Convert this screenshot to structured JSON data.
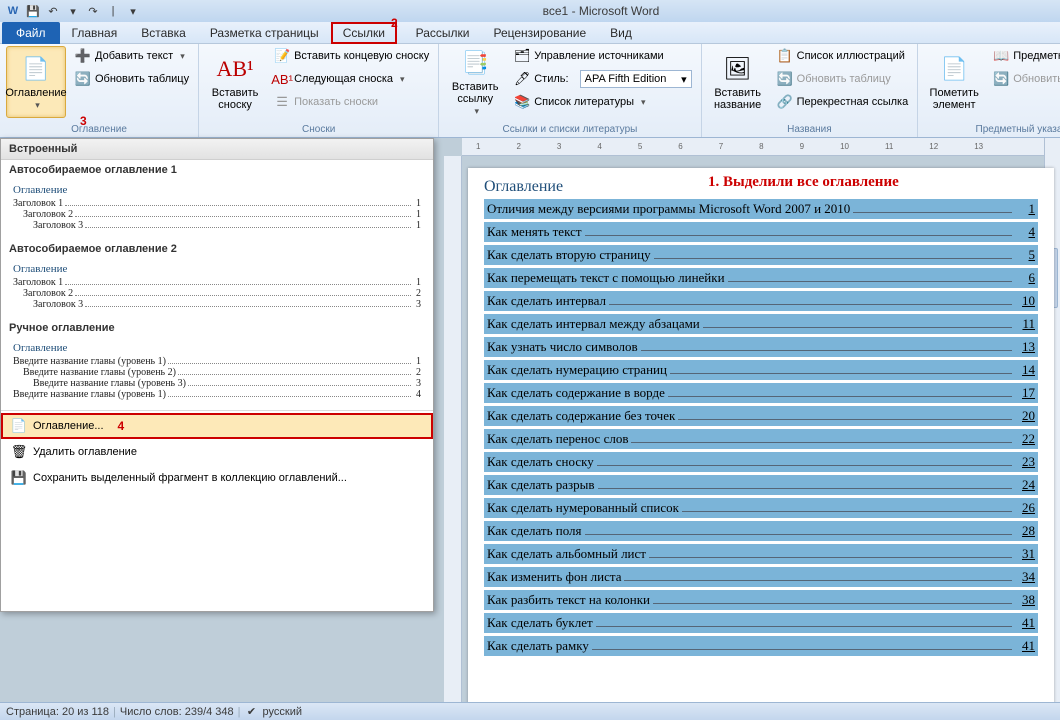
{
  "title": "все1 - Microsoft Word",
  "qat": {
    "save": "💾",
    "undo": "↶",
    "redo": "↷",
    "down": "▾"
  },
  "tabs": {
    "file": "Файл",
    "items": [
      "Главная",
      "Вставка",
      "Разметка страницы",
      "Ссылки",
      "Рассылки",
      "Рецензирование",
      "Вид"
    ],
    "hl_index": 3,
    "callout2": "2"
  },
  "ribbon": {
    "toc": {
      "label": "Оглавление",
      "add_text": "Добавить текст",
      "update": "Обновить таблицу"
    },
    "footnote": {
      "big": "Вставить\nсноску",
      "insert_end": "Вставить концевую сноску",
      "next": "Следующая сноска",
      "show": "Показать сноски",
      "title": "Сноски",
      "ab": "АВ¹"
    },
    "cite": {
      "big": "Вставить\nссылку",
      "manage": "Управление источниками",
      "style_lbl": "Стиль:",
      "style_val": "APA Fifth Edition",
      "biblio": "Список литературы",
      "title": "Ссылки и списки литературы"
    },
    "caption": {
      "big": "Вставить\nназвание",
      "illus": "Список иллюстраций",
      "update_tbl": "Обновить таблицу",
      "cross": "Перекрестная ссылка",
      "title": "Названия"
    },
    "index": {
      "big": "Пометить\nэлемент",
      "subj": "Предметный указатель",
      "update_idx": "Обновить указатель",
      "title": "Предметный указатель"
    },
    "callout3": "3"
  },
  "dropdown": {
    "header": "Встроенный",
    "auto1": "Автособираемое оглавление 1",
    "auto2": "Автособираемое оглавление 2",
    "manual": "Ручное оглавление",
    "toc_title": "Оглавление",
    "h1": "Заголовок 1",
    "h2": "Заголовок 2",
    "h3": "Заголовок 3",
    "m1": "Введите название главы (уровень 1)",
    "m2": "Введите название главы (уровень 2)",
    "m3": "Введите название главы (уровень 3)",
    "m4": "Введите название главы (уровень 1)",
    "pg1": "1",
    "pg2": "2",
    "pg3": "3",
    "pg4": "4",
    "open": "Оглавление...",
    "delete": "Удалить оглавление",
    "save_sel": "Сохранить выделенный фрагмент в коллекцию оглавлений...",
    "callout4": "4"
  },
  "page": {
    "heading": "Оглавление",
    "annot": "1. Выделили все оглавление",
    "lines": [
      {
        "t": "Отличия между версиями программы Microsoft Word 2007 и 2010",
        "p": "1"
      },
      {
        "t": "Как менять текст",
        "p": "4"
      },
      {
        "t": "Как сделать вторую страницу",
        "p": "5"
      },
      {
        "t": "Как перемещать текст с помощью линейки",
        "p": "6"
      },
      {
        "t": "Как сделать интервал",
        "p": "10"
      },
      {
        "t": "Как сделать интервал между абзацами",
        "p": "11"
      },
      {
        "t": "Как узнать число символов",
        "p": "13"
      },
      {
        "t": "Как сделать нумерацию страниц",
        "p": "14"
      },
      {
        "t": "Как сделать содержание в ворде",
        "p": "17"
      },
      {
        "t": "Как сделать содержание без точек",
        "p": "20"
      },
      {
        "t": "Как сделать перенос слов",
        "p": "22"
      },
      {
        "t": "Как сделать сноску",
        "p": "23"
      },
      {
        "t": "Как сделать разрыв",
        "p": "24"
      },
      {
        "t": "Как сделать нумерованный список",
        "p": "26"
      },
      {
        "t": "Как сделать поля",
        "p": "28"
      },
      {
        "t": "Как сделать альбомный лист",
        "p": "31"
      },
      {
        "t": "Как изменить фон листа",
        "p": "34"
      },
      {
        "t": "Как разбить текст на колонки",
        "p": "38"
      },
      {
        "t": "Как сделать буклет",
        "p": "41"
      },
      {
        "t": "Как сделать рамку",
        "p": "41"
      }
    ]
  },
  "status": {
    "page": "Страница: 20 из 118",
    "words": "Число слов: 239/4 348",
    "lang": "русский"
  }
}
